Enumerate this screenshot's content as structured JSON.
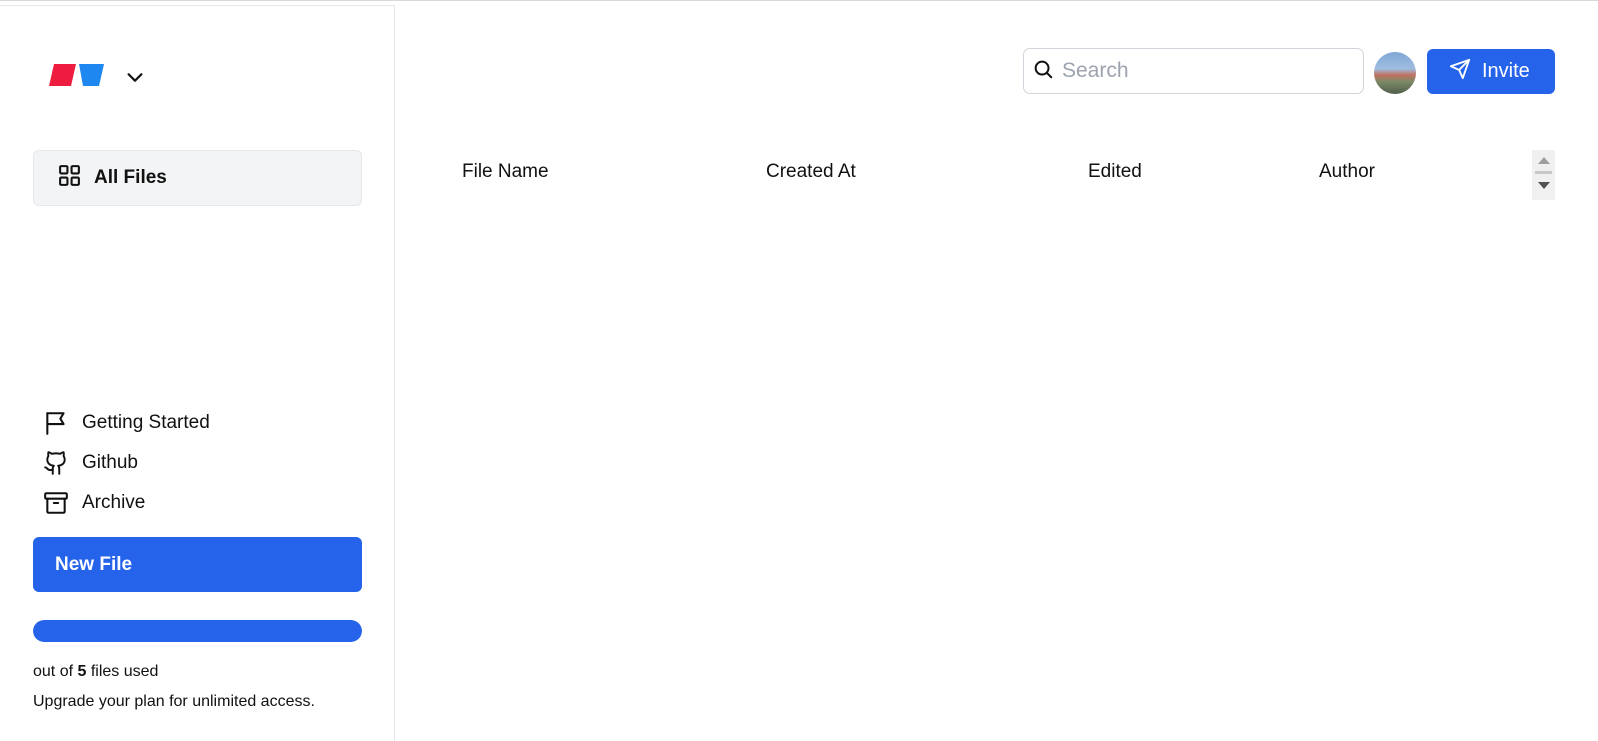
{
  "sidebar": {
    "nav_all_files": "All Files",
    "links": [
      {
        "label": "Getting Started",
        "icon": "flag-icon"
      },
      {
        "label": "Github",
        "icon": "github-icon"
      },
      {
        "label": "Archive",
        "icon": "archive-icon"
      }
    ],
    "new_file_label": "New File",
    "usage": {
      "prefix": "out of",
      "total": "5",
      "suffix": "files used",
      "fill_fraction": 1.0
    },
    "upgrade_text": "Upgrade your plan for unlimited access."
  },
  "header": {
    "search_placeholder": "Search",
    "search_value": "",
    "invite_label": "Invite"
  },
  "table": {
    "columns": [
      "File Name",
      "Created At",
      "Edited",
      "Author"
    ],
    "rows": []
  },
  "colors": {
    "accent": "#2563eb",
    "logo_red": "#ee1d3f",
    "logo_blue": "#1e88f0"
  }
}
